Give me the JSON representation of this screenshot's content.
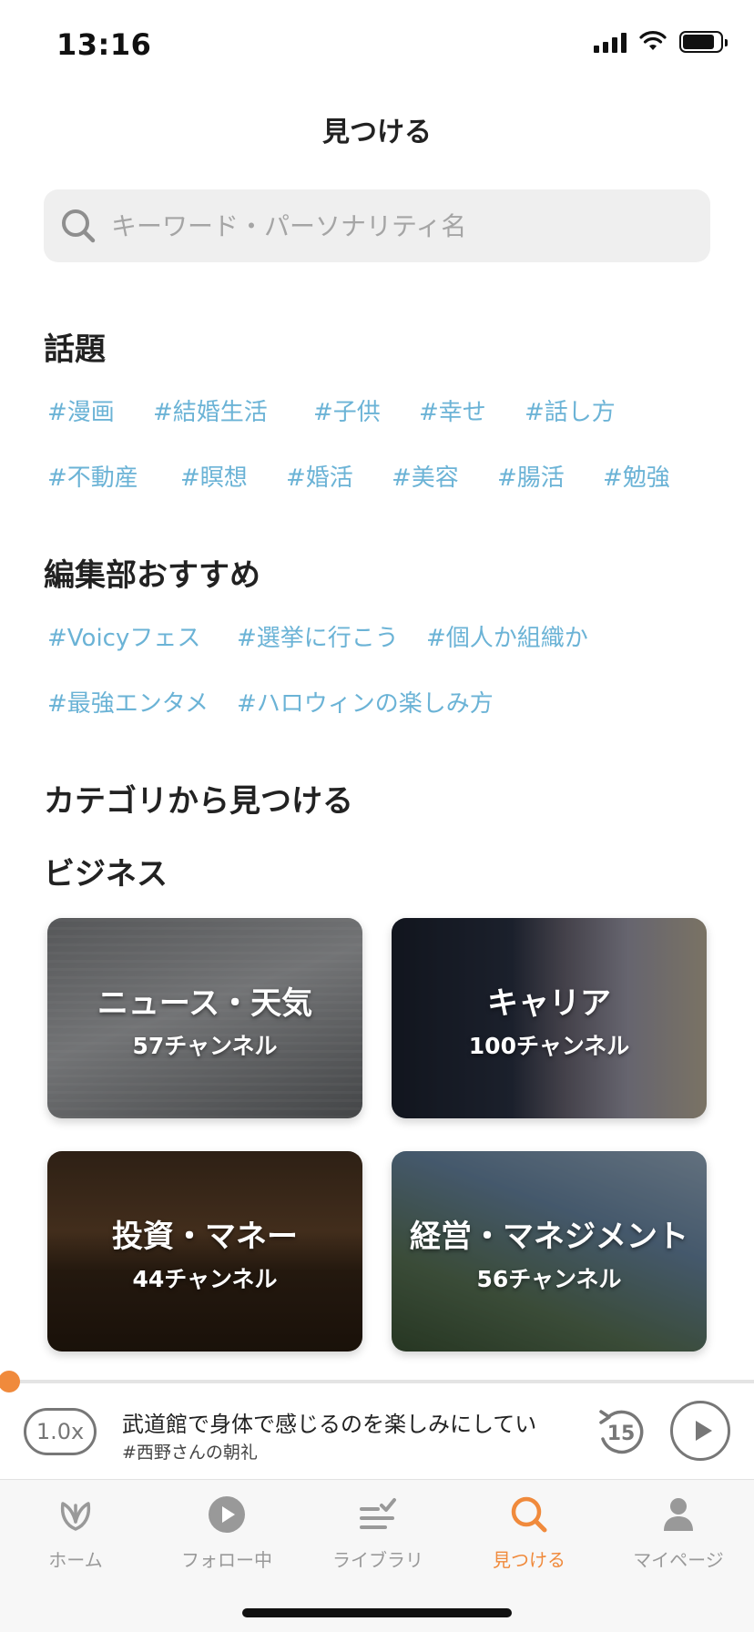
{
  "status_bar": {
    "time": "13:16"
  },
  "header": {
    "title": "見つける"
  },
  "search": {
    "placeholder": "キーワード・パーソナリティ名"
  },
  "topics": {
    "title": "話題",
    "tags": [
      "#漫画",
      "#結婚生活",
      "#子供",
      "#幸せ",
      "#話し方",
      "#不動産",
      "#瞑想",
      "#婚活",
      "#美容",
      "#腸活",
      "#勉強"
    ]
  },
  "editor_picks": {
    "title": "編集部おすすめ",
    "tags": [
      "#Voicyフェス",
      "#選挙に行こう",
      "#個人か組織か",
      "#最強エンタメ",
      "#ハロウィンの楽しみ方"
    ]
  },
  "categories": {
    "title": "カテゴリから見つける",
    "group_title": "ビジネス",
    "cards": [
      {
        "name": "ニュース・天気",
        "count": "57チャンネル"
      },
      {
        "name": "キャリア",
        "count": "100チャンネル"
      },
      {
        "name": "投資・マネー",
        "count": "44チャンネル"
      },
      {
        "name": "経営・マネジメント",
        "count": "56チャンネル"
      }
    ]
  },
  "player": {
    "speed": "1.0x",
    "title": "武道館で身体で感じるのを楽しみにしてい",
    "channel": "#西野さんの朝礼",
    "skip_seconds": "15",
    "progress": 0.01
  },
  "tabs": [
    {
      "label": "ホーム",
      "icon": "home-leaf-icon"
    },
    {
      "label": "フォロー中",
      "icon": "play-circle-icon"
    },
    {
      "label": "ライブラリ",
      "icon": "library-list-icon"
    },
    {
      "label": "見つける",
      "icon": "search-icon",
      "active": true
    },
    {
      "label": "マイページ",
      "icon": "person-icon"
    }
  ],
  "colors": {
    "accent": "#f08a3c",
    "tag": "#6bb3d6"
  }
}
